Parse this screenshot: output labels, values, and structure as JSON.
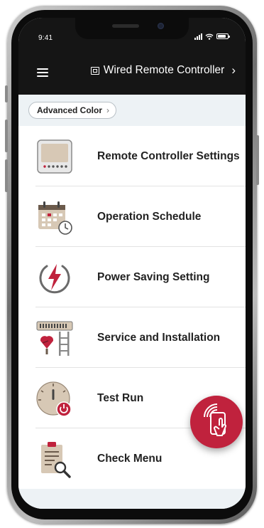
{
  "status_bar": {
    "time": "9:41"
  },
  "header": {
    "device_name": "Wired Remote Controller",
    "chevron": "›"
  },
  "filter_chip": {
    "label": "Advanced Color",
    "chevron": "›"
  },
  "menu_items": [
    {
      "label": "Remote Controller Settings",
      "icon": "remote-controller-icon"
    },
    {
      "label": "Operation Schedule",
      "icon": "calendar-clock-icon"
    },
    {
      "label": "Power Saving Setting",
      "icon": "power-bolt-icon"
    },
    {
      "label": "Service and Installation",
      "icon": "service-tools-icon"
    },
    {
      "label": "Test Run",
      "icon": "dial-power-icon"
    },
    {
      "label": "Check Menu",
      "icon": "clipboard-magnifier-icon"
    }
  ],
  "colors": {
    "accent": "#c0223d",
    "header_bg": "#151515",
    "icon_tan": "#d7c8b5",
    "icon_dark": "#6b5a4b"
  }
}
